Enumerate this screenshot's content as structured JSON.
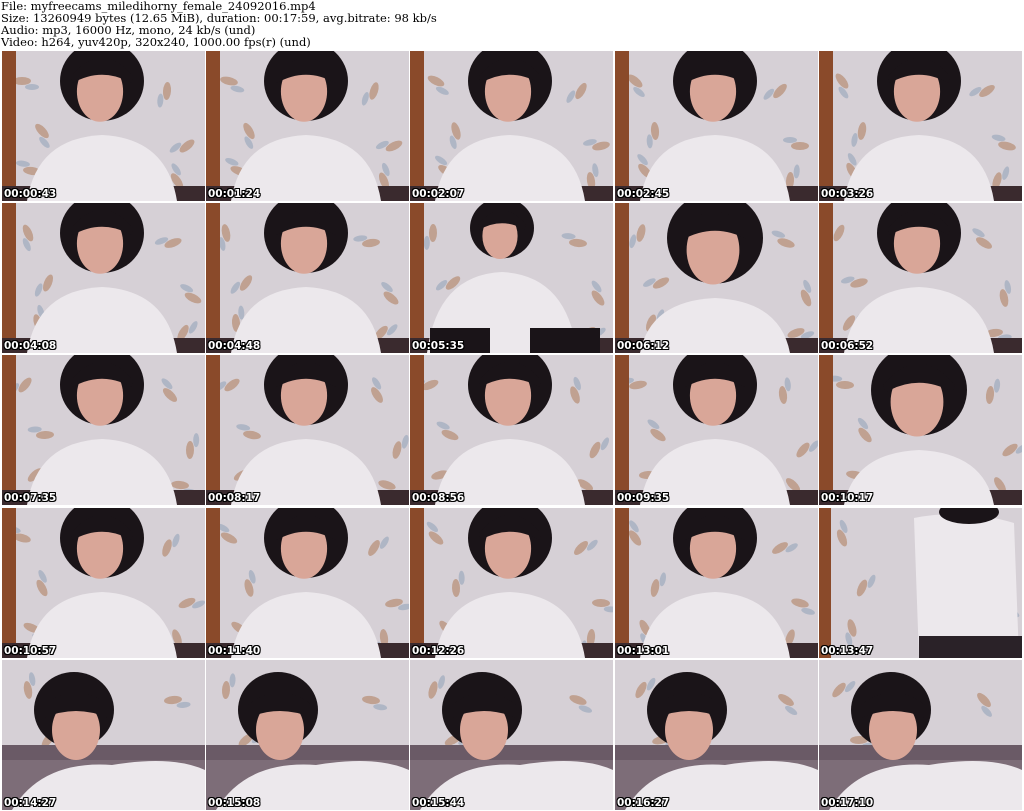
{
  "header": {
    "file_line": "File: myfreecams_miledihorny_female_24092016.mp4",
    "size_line": "Size: 13260949 bytes (12.65 MiB), duration: 00:17:59, avg.bitrate: 98 kb/s",
    "audio_line": "Audio: mp3, 16000 Hz, mono, 24 kb/s (und)",
    "video_line": "Video: h264, yuv420p, 320x240, 1000.00 fps(r) (und)"
  },
  "thumbnails": [
    {
      "time": "00:00:43",
      "scene": "sitting"
    },
    {
      "time": "00:01:24",
      "scene": "sitting"
    },
    {
      "time": "00:02:07",
      "scene": "sitting"
    },
    {
      "time": "00:02:45",
      "scene": "sitting"
    },
    {
      "time": "00:03:26",
      "scene": "sitting"
    },
    {
      "time": "00:04:08",
      "scene": "sitting"
    },
    {
      "time": "00:04:48",
      "scene": "sitting"
    },
    {
      "time": "00:05:35",
      "scene": "standing"
    },
    {
      "time": "00:06:12",
      "scene": "close"
    },
    {
      "time": "00:06:52",
      "scene": "sitting"
    },
    {
      "time": "00:07:35",
      "scene": "sitting"
    },
    {
      "time": "00:08:17",
      "scene": "sitting"
    },
    {
      "time": "00:08:56",
      "scene": "sitting"
    },
    {
      "time": "00:09:35",
      "scene": "sitting"
    },
    {
      "time": "00:10:17",
      "scene": "close"
    },
    {
      "time": "00:10:57",
      "scene": "sitting"
    },
    {
      "time": "00:11:40",
      "scene": "sitting"
    },
    {
      "time": "00:12:26",
      "scene": "sitting"
    },
    {
      "time": "00:13:01",
      "scene": "sitting"
    },
    {
      "time": "00:13:47",
      "scene": "torso"
    },
    {
      "time": "00:14:27",
      "scene": "lying"
    },
    {
      "time": "00:15:08",
      "scene": "lying"
    },
    {
      "time": "00:15:44",
      "scene": "lying"
    },
    {
      "time": "00:16:27",
      "scene": "lying"
    },
    {
      "time": "00:17:10",
      "scene": "lying"
    }
  ],
  "colors": {
    "wall": "#d6d0d6",
    "wallpaper_leaf": "#b8917a",
    "sweater": "#ece8ec",
    "hair": "#1a1418",
    "skin": "#d9a698",
    "wood": "#8a4a2a",
    "bed": "#6a5a66"
  }
}
